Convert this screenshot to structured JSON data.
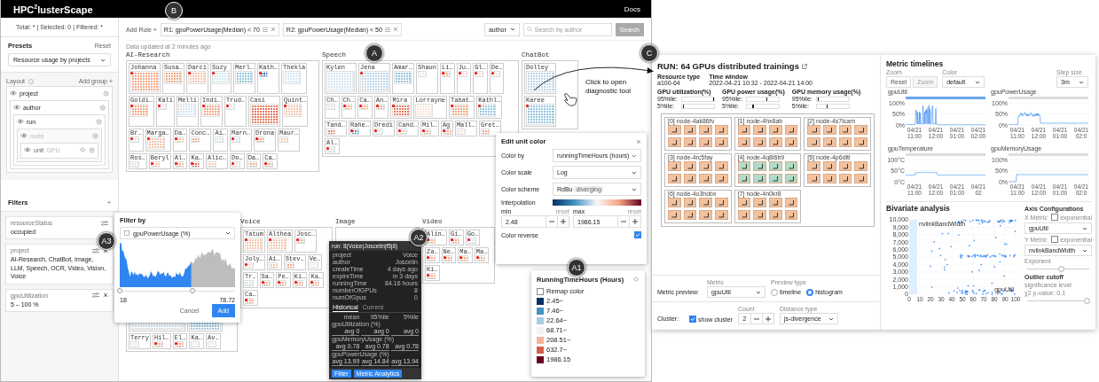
{
  "header": {
    "title": "HPC$^{2}$lusterScape",
    "docs": "Docs"
  },
  "sidebar": {
    "summary": "Total: * | Selected: 0 | Filtered: *",
    "presets": {
      "title": "Presets",
      "reset": "Reset",
      "value": "Resource usage by projects"
    },
    "layout": {
      "title": "Layout",
      "add_group": "Add group +",
      "levels": [
        {
          "label": "project",
          "disabled": false,
          "children": [
            {
              "label": "author",
              "disabled": false,
              "children": [
                {
                  "label": "run",
                  "disabled": false,
                  "children": [
                    {
                      "label": "node",
                      "disabled": true,
                      "children": [
                        {
                          "prefix": "unit",
                          "label": "GPU"
                        }
                      ]
                    }
                  ]
                }
              ]
            }
          ]
        }
      ]
    },
    "filters": {
      "title": "Filters",
      "add": "+",
      "items": [
        {
          "name": "resourceStatus",
          "value": "occupied",
          "removable": false
        },
        {
          "name": "project",
          "value": "AI-Research, ChatBot, Image, LLM, Speech, OCR, Video, Vision, Voice",
          "removable": true
        },
        {
          "name": "gpuUtilization",
          "value": "5 – 100 %",
          "removable": true
        }
      ]
    }
  },
  "toolbar": {
    "add_rule": "Add Rule +",
    "rules": [
      {
        "label": "R1: gpuPowerUsage(Median) < 70"
      },
      {
        "label": "R2: gpuPowerUsage(Median) < 50"
      }
    ],
    "search_field": "author",
    "search_placeholder": "Search by author",
    "search_button": "Search",
    "updated": "Data updated at 2 minutes ago"
  },
  "treemap": {
    "groups": [
      {
        "name": "AI-Research",
        "authors": [
          {
            "name": "Johanna",
            "kind": "large",
            "color": "#f4a582",
            "alert": true
          },
          {
            "name": "Susa…",
            "kind": "medium",
            "color": "#f4a582",
            "alert": false
          },
          {
            "name": "Darci",
            "kind": "medium",
            "color": "#f7c4ab",
            "alert": true
          },
          {
            "name": "Suzy",
            "kind": "medium",
            "color": "#d1e5f0",
            "alert": true
          },
          {
            "name": "Merl…",
            "kind": "medium",
            "color": "#92c5de",
            "alert": false
          },
          {
            "name": "Kath…",
            "kind": "small",
            "color": "#2166ac",
            "alert": true
          },
          {
            "name": "Thekla",
            "kind": "medium",
            "color": "#d1e5f0",
            "alert": false
          },
          {
            "name": "Goldi…",
            "kind": "medium",
            "color": "#f4a582",
            "alert": true
          },
          {
            "name": "Kali",
            "kind": "small",
            "color": "#d1e5f0",
            "alert": true
          },
          {
            "name": "Melli",
            "kind": "medium",
            "color": "#d1e5f0",
            "alert": false
          },
          {
            "name": "Indi…",
            "kind": "medium",
            "color": "#f4a582",
            "alert": true
          },
          {
            "name": "Trud…",
            "kind": "small",
            "color": "#fbe3d6",
            "alert": true
          },
          {
            "name": "Casi",
            "kind": "large",
            "color": "#e9785f",
            "alert": false
          },
          {
            "name": "Quint…",
            "kind": "medium",
            "color": "#f7c4ab",
            "alert": true
          },
          {
            "name": "Br…",
            "kind": "small",
            "color": "#d1e5f0",
            "alert": true
          },
          {
            "name": "Marga…",
            "kind": "medium",
            "color": "#f7c4ab",
            "alert": true
          },
          {
            "name": "Da…",
            "kind": "small",
            "color": "#f7c4ab",
            "alert": true
          },
          {
            "name": "Conc…",
            "kind": "small",
            "color": "#f4a582",
            "alert": false
          },
          {
            "name": "Ai…",
            "kind": "small",
            "color": "#d1e5f0",
            "alert": false
          },
          {
            "name": "Marn…",
            "kind": "small",
            "color": "#d1e5f0",
            "alert": true
          },
          {
            "name": "Drona",
            "kind": "small",
            "color": "#f4a582",
            "alert": true
          },
          {
            "name": "Maur…",
            "kind": "small",
            "color": "#f7c4ab",
            "alert": false
          },
          {
            "name": "Ros…",
            "kind": "small",
            "color": "#d1e5f0",
            "alert": false
          },
          {
            "name": "Beryl",
            "kind": "small",
            "color": "#f7c4ab",
            "alert": true
          },
          {
            "name": "Al…",
            "kind": "small",
            "color": "#f4a582",
            "alert": true
          },
          {
            "name": "Ka…",
            "kind": "small",
            "color": "#d6604d",
            "alert": true
          },
          {
            "name": "Alic…",
            "kind": "small",
            "color": "#f7c4ab",
            "alert": false
          },
          {
            "name": "Do…",
            "kind": "small",
            "color": "#fbe3d6",
            "alert": true
          },
          {
            "name": "Da…",
            "kind": "small",
            "color": "#f4a582",
            "alert": false
          },
          {
            "name": "Ca…",
            "kind": "small",
            "color": "#f4a582",
            "alert": true
          }
        ]
      },
      {
        "name": "Speech",
        "authors": [
          {
            "name": "Kylen",
            "kind": "large",
            "color": "#d1e5f0",
            "alert": false
          },
          {
            "name": "Jena",
            "kind": "large",
            "color": "#bcd8ea",
            "alert": true
          },
          {
            "name": "Amar…",
            "kind": "medium",
            "color": "#92c5de",
            "alert": false
          },
          {
            "name": "Shaun",
            "kind": "small",
            "color": "#fbe3d6",
            "alert": false
          },
          {
            "name": "Li…",
            "kind": "small",
            "color": "#f4a582",
            "alert": true
          },
          {
            "name": "Ju…",
            "kind": "small",
            "color": "#fbe3d6",
            "alert": true
          },
          {
            "name": "Gl…",
            "kind": "small",
            "color": "#fbe3d6",
            "alert": true
          },
          {
            "name": "De…",
            "kind": "small",
            "color": "#fbe3d6",
            "alert": true
          },
          {
            "name": "Ch…",
            "kind": "small",
            "color": "#d1e5f0",
            "alert": false
          },
          {
            "name": "Ch…",
            "kind": "small",
            "color": "#f4a582",
            "alert": true
          },
          {
            "name": "Ca…",
            "kind": "small",
            "color": "#f4a582",
            "alert": true
          },
          {
            "name": "An…",
            "kind": "small",
            "color": "#f4a582",
            "alert": true
          },
          {
            "name": "Mira",
            "kind": "medium",
            "color": "#e9785f",
            "alert": true
          },
          {
            "name": "Lorrayne",
            "kind": "medium",
            "color": "#fbe3d6",
            "alert": false
          },
          {
            "name": "Tabat…",
            "kind": "medium",
            "color": "#f4a582",
            "alert": true
          },
          {
            "name": "Kathl…",
            "kind": "medium",
            "color": "#92c5de",
            "alert": true
          },
          {
            "name": "Tand…",
            "kind": "small",
            "color": "#e9785f",
            "alert": false
          },
          {
            "name": "Rahe…",
            "kind": "small",
            "color": "#4393c3",
            "alert": true
          },
          {
            "name": "Dredi",
            "kind": "small",
            "color": "#d1e5f0",
            "alert": true
          },
          {
            "name": "Cand…",
            "kind": "small",
            "color": "#f7c4ab",
            "alert": true
          },
          {
            "name": "Mil…",
            "kind": "small",
            "color": "#f4a582",
            "alert": true
          },
          {
            "name": "Ag",
            "kind": "small",
            "color": "#f4a582",
            "alert": true
          },
          {
            "name": "Mall…",
            "kind": "small",
            "color": "#fbe3d6",
            "alert": false
          },
          {
            "name": "Gret…",
            "kind": "small",
            "color": "#f4a582",
            "alert": false
          },
          {
            "name": "Al…",
            "kind": "small",
            "color": "#d1e5f0",
            "alert": true
          }
        ]
      },
      {
        "name": "ChatBot",
        "authors": [
          {
            "name": "Dolley",
            "kind": "large",
            "color": "#bcd8ea",
            "alert": false
          },
          {
            "name": "Karee",
            "kind": "large",
            "color": "#92c5de",
            "alert": true
          }
        ]
      },
      {
        "authors": [
          {
            "kind": "huge",
            "color": "#d1e5f0",
            "alert": false
          },
          {
            "kind": "tall",
            "color": "#92c5de",
            "alert": true
          },
          {
            "name": "Terry",
            "kind": "small",
            "color": "#e3ecf2",
            "alert": false
          },
          {
            "name": "Hil…",
            "kind": "small",
            "color": "#f4a582",
            "alert": true
          },
          {
            "name": "El…",
            "kind": "small",
            "color": "#f4a582",
            "alert": true
          },
          {
            "name": "Ka…",
            "kind": "small",
            "color": "#eeeeee",
            "alert": false
          },
          {
            "name": "Av…",
            "kind": "small",
            "color": "#eeeeee",
            "alert": false
          }
        ]
      },
      {
        "name": "Voice",
        "authors": [
          {
            "name": "Tatum",
            "kind": "medium",
            "color": "#f7c4ab",
            "alert": true
          },
          {
            "name": "Althea",
            "kind": "medium",
            "color": "#f7c4ab",
            "alert": true
          },
          {
            "name": "Josc…",
            "kind": "small",
            "color": "#f4a582",
            "alert": true
          },
          {
            "name": "Joly…",
            "kind": "small",
            "color": "#fbe3d6",
            "alert": true
          },
          {
            "name": "Ai…",
            "kind": "small",
            "color": "#f7c4ab",
            "alert": false
          },
          {
            "name": "Stev…",
            "kind": "small",
            "color": "#f4a582",
            "alert": false
          },
          {
            "name": "Ve…",
            "kind": "small",
            "color": "#eeeeee",
            "alert": false
          },
          {
            "name": "Tr…",
            "kind": "small",
            "color": "#d1e5f0",
            "alert": false
          },
          {
            "name": "Sa…",
            "kind": "small",
            "color": "#f4a582",
            "alert": true
          },
          {
            "name": "Pe…",
            "kind": "small",
            "color": "#f4a582",
            "alert": true
          },
          {
            "name": "Ki…",
            "kind": "small",
            "color": "#f4a582",
            "alert": true
          },
          {
            "name": "Ka…",
            "kind": "small",
            "color": "#f4a582",
            "alert": true
          },
          {
            "name": "Ca…",
            "kind": "small",
            "color": "#f4a582",
            "alert": true
          }
        ]
      },
      {
        "name": "Image"
      },
      {
        "name": "Video",
        "authors": [
          {
            "name": "Alin…",
            "kind": "small",
            "color": "#f4a582",
            "alert": true
          },
          {
            "name": "Gi…",
            "kind": "small",
            "color": "#f4a582",
            "alert": true
          },
          {
            "name": "Go…",
            "kind": "small",
            "color": "#d1e5f0",
            "alert": true
          },
          {
            "name": "Za…",
            "kind": "small",
            "color": "#f4a582",
            "alert": true
          },
          {
            "name": "Ne…",
            "kind": "small",
            "color": "#f4a582",
            "alert": true
          },
          {
            "name": "Ma…",
            "kind": "small",
            "color": "#f4a582",
            "alert": true
          },
          {
            "name": "Ma…",
            "kind": "small",
            "color": "#f4a582",
            "alert": true
          },
          {
            "name": "Ki…",
            "kind": "small",
            "color": "#f4a582",
            "alert": true
          }
        ]
      }
    ]
  },
  "filter_popup": {
    "title": "Filter by",
    "metric": "gpuPowerUsage (%)",
    "thumbs": [
      {
        "level": 0
      },
      {
        "level": 0.63
      }
    ],
    "min": "18",
    "max": "78.72",
    "cancel": "Cancel",
    "add": "Add"
  },
  "tooltip": {
    "title": "run: 8(Voice|Joscelin|f5j8)",
    "fields": [
      {
        "label": "project",
        "value": "Voice"
      },
      {
        "label": "author",
        "value": "Joscelin"
      },
      {
        "label": "createTime",
        "value": "4 days ago"
      },
      {
        "label": "expireTime",
        "value": "in 3 days"
      },
      {
        "label": "runningTime",
        "value": "84.16 hours"
      },
      {
        "label": "numberOfGPUs",
        "value": "8"
      },
      {
        "label": "numOfGpus",
        "value": "0"
      }
    ],
    "tabs": [
      {
        "label": "Historical",
        "selected": true
      },
      {
        "label": "Current",
        "selected": false
      }
    ],
    "columns": [
      "mean",
      "95%ile",
      "5%ile"
    ],
    "metrics": [
      {
        "name": "gpuUtilization (%)",
        "values": [
          "avg 0",
          "avg 0",
          "avg 0"
        ]
      },
      {
        "name": "gpuMemoryUsage (%)",
        "values": [
          "avg 0.78",
          "avg 0.78",
          "avg 0.78"
        ]
      },
      {
        "name": "gpuPowerUsage (%)",
        "values": [
          "avg 13.99",
          "avg 14.84",
          "avg 13.94"
        ]
      }
    ],
    "buttons": [
      "Filter",
      "Metric Analytics"
    ]
  },
  "color_editor": {
    "title": "Edit unit color",
    "rows": [
      {
        "label": "Color by",
        "value": "runningTimeHours (hours)"
      },
      {
        "label": "Color scale",
        "value": "Log"
      },
      {
        "label": "Color scheme",
        "value": "RdBu",
        "tag": "diverging"
      }
    ],
    "interpolation": "Interpolation",
    "min": {
      "label": "min",
      "reset": "reset",
      "value": "2.48"
    },
    "max": {
      "label": "max",
      "reset": "reset",
      "value": "1986.15"
    },
    "reverse": {
      "label": "Color reverse",
      "checked": true
    }
  },
  "legend": {
    "title": "RunningTimeHours (Hours)",
    "remap": {
      "label": "Remap color",
      "checked": false
    },
    "items": [
      {
        "label": "2.45~",
        "color": "#053061"
      },
      {
        "label": "7.46~",
        "color": "#4393c3"
      },
      {
        "label": "22.64~",
        "color": "#a6cee3"
      },
      {
        "label": "68.71~",
        "color": "#f2f2f2"
      },
      {
        "label": "208.51~",
        "color": "#f4b497"
      },
      {
        "label": "632.7~",
        "color": "#d6604d"
      },
      {
        "label": "1986.15",
        "color": "#67001f"
      }
    ]
  },
  "annotations": [
    {
      "label": "B"
    },
    {
      "label": "A"
    },
    {
      "label": "A3"
    },
    {
      "label": "A2"
    },
    {
      "label": "A1"
    },
    {
      "label": "C"
    }
  ],
  "callout": "Click to open diagnostic tool",
  "diagnostic": {
    "title": "RUN: 64 GPUs distributed trainings",
    "info": [
      {
        "label": "Resource type",
        "value": "a100-64"
      },
      {
        "label": "Time window",
        "value": "2022-04-21 10:32 - 2022-04-21 14:00"
      }
    ],
    "metrics": [
      {
        "name": "GPU utilization(%)",
        "rows": [
          {
            "label": "95%ile:",
            "level": 0.97
          },
          {
            "label": "5%ile:",
            "level": 0.02
          }
        ]
      },
      {
        "name": "GPU power usage(%)",
        "rows": [
          {
            "label": "95%ile:",
            "level": 0.6
          },
          {
            "label": "5%ile:",
            "level": 0.17
          }
        ]
      },
      {
        "name": "GPU memory usage(%)",
        "rows": [
          {
            "label": "95%ile:",
            "level": 0.02
          },
          {
            "label": "5%ile:",
            "level": 0.3
          }
        ]
      }
    ],
    "nodes": [
      {
        "label": "[0] node-4ak86fv",
        "color": "#f2c29e"
      },
      {
        "label": "[1] node-4hx8ab",
        "color": "#f2c29e"
      },
      {
        "label": "[2] node-4s7lcam",
        "color": "#f2c29e"
      },
      {
        "label": "[3] node-4rc5fay",
        "color": "#f2c29e"
      },
      {
        "label": "[4] node-4q8i6b9",
        "color": "#b2dcc6"
      },
      {
        "label": "[5] node-4p6dltl",
        "color": "#f2c29e"
      },
      {
        "label": "[6] node-4o3hobx",
        "color": "#f2c29e"
      },
      {
        "label": "[7] node-4n0kr8",
        "color": "#f2c29e"
      }
    ],
    "preview": {
      "label": "Metric preview:",
      "metric_label": "Metric",
      "metric": "gpuUtil",
      "type_label": "Preview type",
      "types": [
        {
          "label": "timeline",
          "selected": false
        },
        {
          "label": "histogram",
          "selected": true
        }
      ]
    },
    "cluster": {
      "label": "Cluster:",
      "show": {
        "label": "show cluster",
        "checked": true
      },
      "count_label": "Count",
      "count": "2",
      "distance_label": "Distance type",
      "distance": "js-divergence"
    },
    "timelines": {
      "title": "Metric timelines",
      "zoom_label": "Zoom",
      "reset": "Reset",
      "zoom": "Zoom",
      "zoom_disabled": true,
      "color_label": "Color",
      "color_mode": "default",
      "step_label": "Step size",
      "step": "3m",
      "charts": [
        {
          "name": "gpuUtil",
          "y_labels": [
            "100%",
            "50%",
            "0%"
          ],
          "x_labels": [
            "04/21 11:00",
            "04/21 12:00",
            "04/21 01:00",
            "04/21 02:00"
          ]
        },
        {
          "name": "gpuPowerUsage",
          "y_labels": [
            "100%",
            "50%",
            "0%"
          ],
          "x_labels": [
            "04/21 11:00",
            "04/21 12:00",
            "04/21 01:00",
            "04/21 02:0"
          ]
        },
        {
          "name": "gpuTemperature",
          "y_labels": [
            "100°C",
            "50°C",
            "0°C"
          ],
          "x_labels": [
            "04/21 11:00",
            "04/21 12:00",
            "04/21 01:00",
            "04/21 02"
          ]
        },
        {
          "name": "gpuMemoryUsage",
          "y_labels": [
            "100%",
            "50%",
            "0%"
          ],
          "x_labels": [
            "04/21 11:00",
            "04/21 12:00",
            "04/21 01:00",
            "04/21 02:0"
          ]
        }
      ]
    },
    "bivariate": {
      "title": "Bivariate analysis",
      "y_name": "nvlinkBandWidth",
      "x_name": "gpuUtil",
      "y_labels": [
        "10,000",
        "9,000",
        "8,000",
        "7,000",
        "6,000",
        "5,000",
        "4,000",
        "3,000",
        "2,000",
        "1,000",
        "0"
      ],
      "x_labels": [
        "0",
        "10",
        "20",
        "30",
        "40",
        "50",
        "60",
        "70",
        "80",
        "90",
        "100"
      ],
      "axis_title": "Axis Configurations",
      "axes": [
        {
          "label": "X Metric",
          "option": "exponential",
          "checked": false,
          "value": "gpuUtil"
        },
        {
          "label": "Y Metric",
          "option": "exponential",
          "checked": false,
          "value": "nvlinkBandWidth"
        }
      ],
      "exponent": {
        "label": "Exponent",
        "level": 0.55
      },
      "outlier": {
        "title": "Outlier cutoff",
        "label": "significance level",
        "sub": "χ2 p-value: 0.1",
        "level": 0.96
      }
    }
  }
}
